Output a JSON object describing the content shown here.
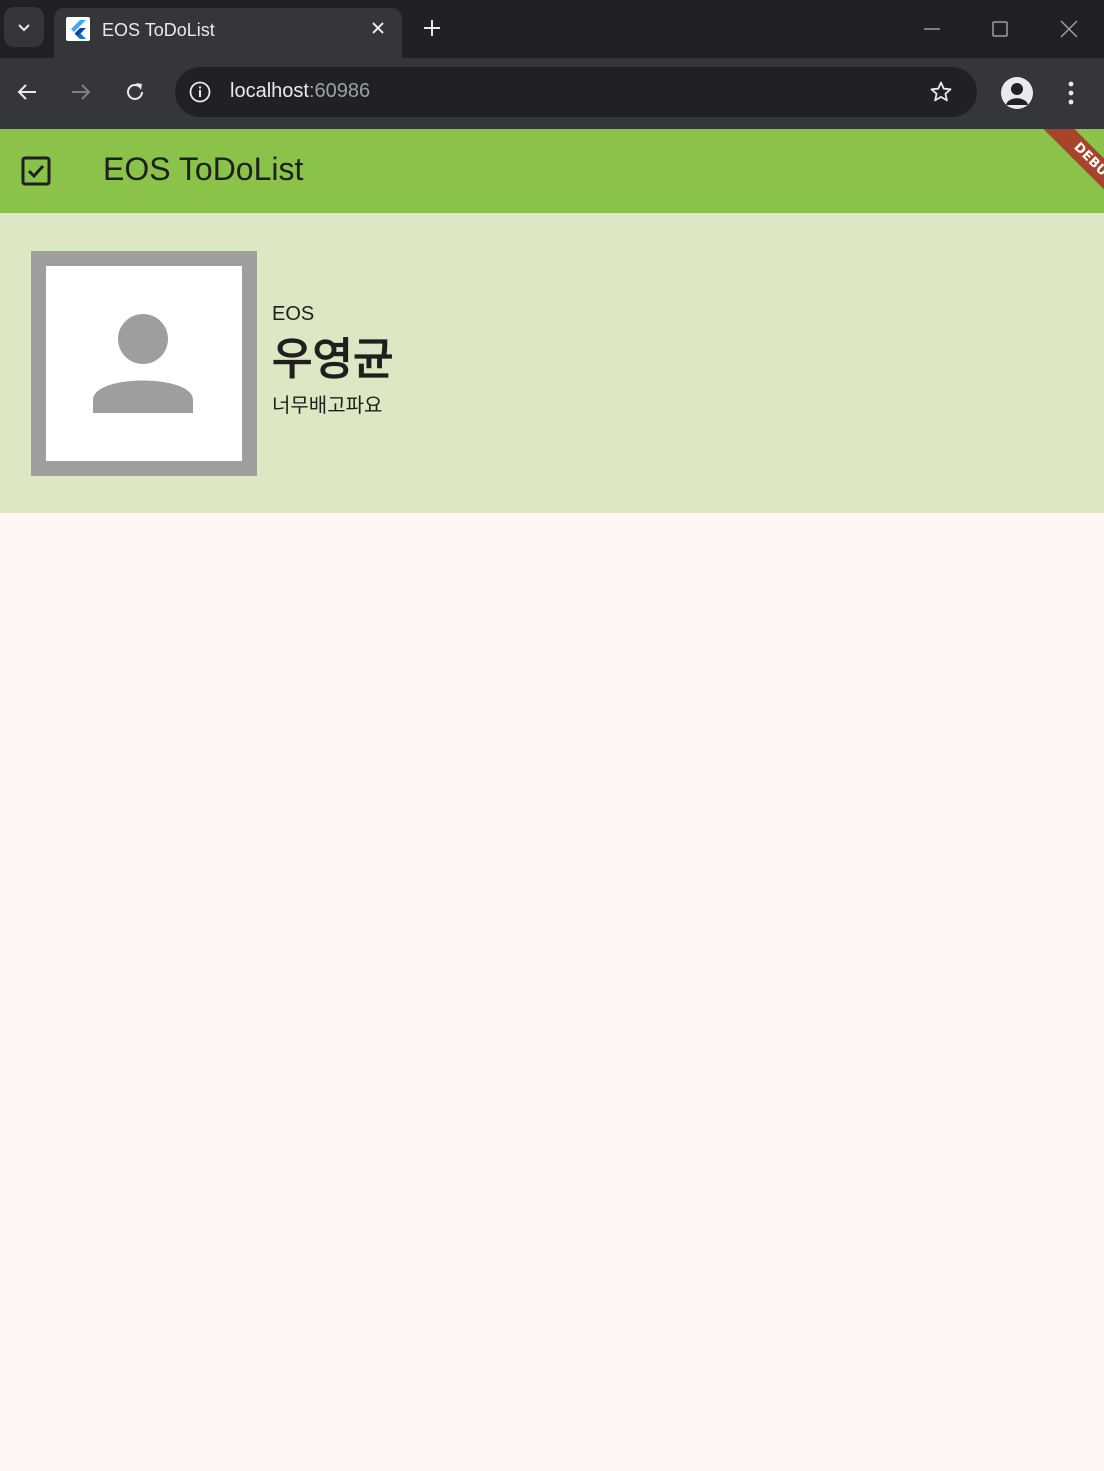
{
  "browser": {
    "tab_title": "EOS ToDoList",
    "url_host": "localhost",
    "url_port": ":60986"
  },
  "appbar": {
    "title": "EOS ToDoList",
    "leading_icon": "checkbox-icon",
    "color": "#8bc34a",
    "debug_banner": "DEBUG"
  },
  "profile": {
    "org": "EOS",
    "name": "우영균",
    "status": "너무배고파요",
    "avatar_icon": "person-icon",
    "card_color": "#dce8c3"
  },
  "background_color": "#fff5f3"
}
